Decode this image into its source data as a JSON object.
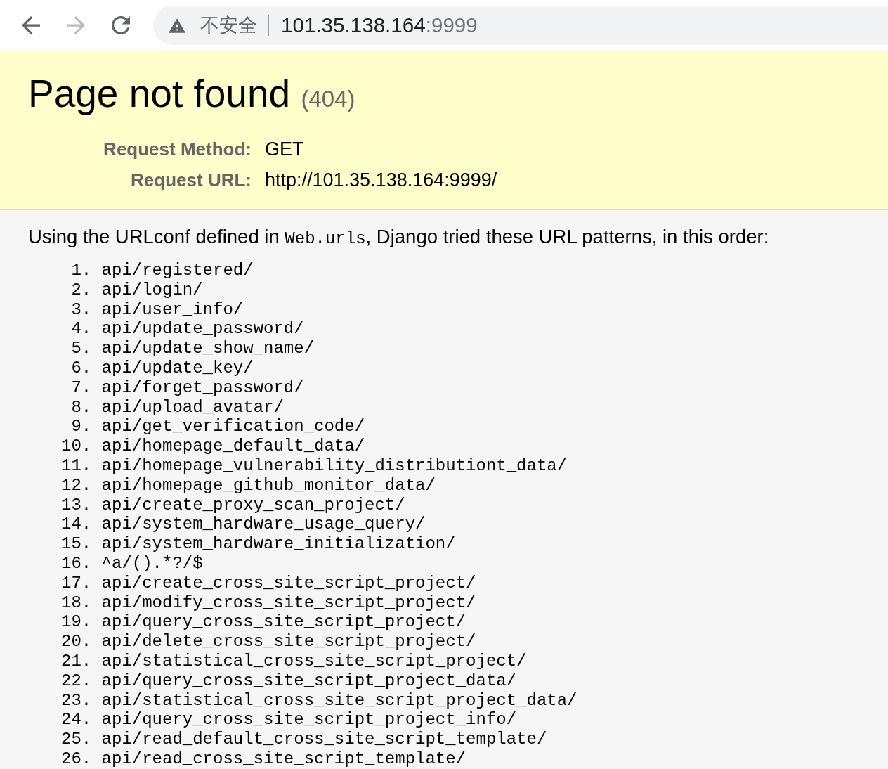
{
  "browser": {
    "nav_buttons": [
      {
        "kind": "back",
        "disabled": false
      },
      {
        "kind": "forward",
        "disabled": true
      },
      {
        "kind": "reload",
        "disabled": false
      }
    ],
    "address_bar": {
      "security_label": "不安全",
      "host": "101.35.138.164",
      "port": ":9999"
    }
  },
  "summary": {
    "title": "Page not found",
    "status": "(404)",
    "fields": [
      {
        "label": "Request Method:",
        "value": "GET"
      },
      {
        "label": "Request URL:",
        "value": "http://101.35.138.164:9999/"
      }
    ]
  },
  "info": {
    "intro": [
      {
        "kind": "text",
        "text": "Using the URLconf defined in "
      },
      {
        "kind": "code",
        "text": "Web.urls"
      },
      {
        "kind": "text",
        "text": ", Django tried these URL patterns, in this order:"
      }
    ],
    "patterns": [
      {
        "number": "1.",
        "pattern": "api/registered/"
      },
      {
        "number": "2.",
        "pattern": "api/login/"
      },
      {
        "number": "3.",
        "pattern": "api/user_info/"
      },
      {
        "number": "4.",
        "pattern": "api/update_password/"
      },
      {
        "number": "5.",
        "pattern": "api/update_show_name/"
      },
      {
        "number": "6.",
        "pattern": "api/update_key/"
      },
      {
        "number": "7.",
        "pattern": "api/forget_password/"
      },
      {
        "number": "8.",
        "pattern": "api/upload_avatar/"
      },
      {
        "number": "9.",
        "pattern": "api/get_verification_code/"
      },
      {
        "number": "10.",
        "pattern": "api/homepage_default_data/"
      },
      {
        "number": "11.",
        "pattern": "api/homepage_vulnerability_distributiont_data/"
      },
      {
        "number": "12.",
        "pattern": "api/homepage_github_monitor_data/"
      },
      {
        "number": "13.",
        "pattern": "api/create_proxy_scan_project/"
      },
      {
        "number": "14.",
        "pattern": "api/system_hardware_usage_query/"
      },
      {
        "number": "15.",
        "pattern": "api/system_hardware_initialization/"
      },
      {
        "number": "16.",
        "pattern": "^a/().*?/$"
      },
      {
        "number": "17.",
        "pattern": "api/create_cross_site_script_project/"
      },
      {
        "number": "18.",
        "pattern": "api/modify_cross_site_script_project/"
      },
      {
        "number": "19.",
        "pattern": "api/query_cross_site_script_project/"
      },
      {
        "number": "20.",
        "pattern": "api/delete_cross_site_script_project/"
      },
      {
        "number": "21.",
        "pattern": "api/statistical_cross_site_script_project/"
      },
      {
        "number": "22.",
        "pattern": "api/query_cross_site_script_project_data/"
      },
      {
        "number": "23.",
        "pattern": "api/statistical_cross_site_script_project_data/"
      },
      {
        "number": "24.",
        "pattern": "api/query_cross_site_script_project_info/"
      },
      {
        "number": "25.",
        "pattern": "api/read_default_cross_site_script_template/"
      },
      {
        "number": "26.",
        "pattern": "api/read_cross_site_script_template/"
      }
    ]
  }
}
